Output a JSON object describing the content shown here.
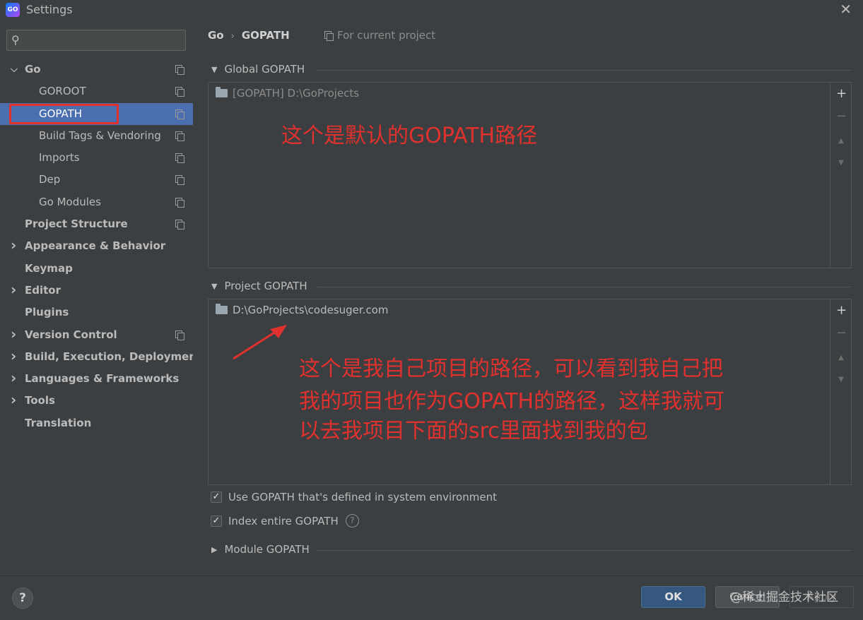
{
  "window": {
    "title": "Settings",
    "app_icon": "GO"
  },
  "search": {
    "placeholder": ""
  },
  "sidebar": {
    "items": [
      {
        "label": "Go",
        "bold": true,
        "arrow": "down"
      },
      {
        "label": "GOROOT"
      },
      {
        "label": "GOPATH",
        "selected": true
      },
      {
        "label": "Build Tags & Vendoring"
      },
      {
        "label": "Imports"
      },
      {
        "label": "Dep"
      },
      {
        "label": "Go Modules"
      },
      {
        "label": "Project Structure",
        "bold": true
      },
      {
        "label": "Appearance & Behavior",
        "bold": true,
        "arrow": "right"
      },
      {
        "label": "Keymap",
        "bold": true
      },
      {
        "label": "Editor",
        "bold": true,
        "arrow": "right"
      },
      {
        "label": "Plugins",
        "bold": true
      },
      {
        "label": "Version Control",
        "bold": true,
        "arrow": "right"
      },
      {
        "label": "Build, Execution, Deployment",
        "bold": true,
        "arrow": "right"
      },
      {
        "label": "Languages & Frameworks",
        "bold": true,
        "arrow": "right"
      },
      {
        "label": "Tools",
        "bold": true,
        "arrow": "right"
      },
      {
        "label": "Translation",
        "bold": true
      }
    ]
  },
  "header": {
    "breadcrumb": [
      "Go",
      "GOPATH"
    ],
    "separator": "›",
    "scope": "For current project"
  },
  "global_gopath": {
    "title": "Global GOPATH",
    "entries": [
      "[GOPATH] D:\\GoProjects"
    ]
  },
  "project_gopath": {
    "title": "Project GOPATH",
    "entries": [
      "D:\\GoProjects\\codesuger.com"
    ]
  },
  "toolbar": {
    "add": "+",
    "remove": "−",
    "up": "▲",
    "down": "▼"
  },
  "annotations": {
    "global_note": "这个是默认的GOPATH路径",
    "project_note_lines": [
      "这个是我自己项目的路径，可以看到我自己把",
      "我的项目也作为GOPATH的路径，这样我就可",
      "以去我项目下面的src里面找到我的包"
    ],
    "color": "#e0312e"
  },
  "options": {
    "use_env": {
      "label": "Use GOPATH that's defined in system environment",
      "checked": true
    },
    "index_entire": {
      "label": "Index entire GOPATH",
      "checked": true
    }
  },
  "module_gopath": {
    "title": "Module GOPATH"
  },
  "footer": {
    "help": "?",
    "ok": "OK",
    "cancel": "Cancel",
    "apply": "Apply",
    "watermark": "@稀土掘金技术社区"
  },
  "colors": {
    "selection": "#4b6eaf",
    "ok_button": "#365880",
    "background": "#3c3f41"
  }
}
